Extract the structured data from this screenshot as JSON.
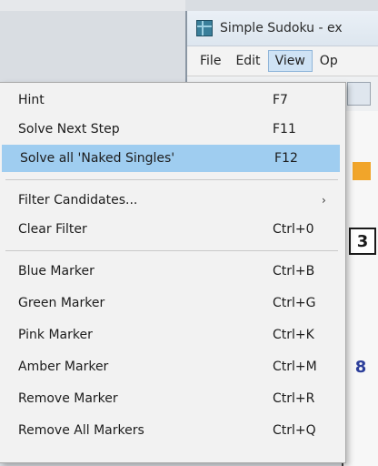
{
  "window": {
    "title": "Simple Sudoku - ex",
    "menubar": [
      "File",
      "Edit",
      "View",
      "Op"
    ],
    "active_menu": "View"
  },
  "grid": {
    "visible_digits": [
      "3",
      "8"
    ]
  },
  "menu": {
    "items": [
      {
        "label": "Hint",
        "shortcut": "F7"
      },
      {
        "label": "Solve Next Step",
        "shortcut": "F11"
      },
      {
        "label": "Solve all 'Naked Singles'",
        "shortcut": "F12",
        "highlighted": true
      },
      {
        "label": "Filter Candidates...",
        "shortcut": "",
        "submenu": true
      },
      {
        "label": "Clear Filter",
        "shortcut": "Ctrl+0"
      },
      {
        "label": "Blue Marker",
        "shortcut": "Ctrl+B"
      },
      {
        "label": "Green Marker",
        "shortcut": "Ctrl+G"
      },
      {
        "label": "Pink Marker",
        "shortcut": "Ctrl+K"
      },
      {
        "label": "Amber Marker",
        "shortcut": "Ctrl+M"
      },
      {
        "label": "Remove Marker",
        "shortcut": "Ctrl+R"
      },
      {
        "label": "Remove All Markers",
        "shortcut": "Ctrl+Q"
      }
    ],
    "submenu_arrow": "›"
  },
  "colors": {
    "highlight": "#9fcdf0",
    "orange_cell": "#f1a52a",
    "digit_blue": "#2c3e9a"
  }
}
